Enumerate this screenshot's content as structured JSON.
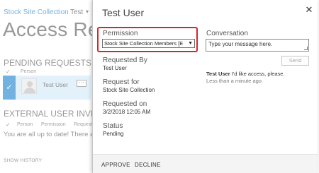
{
  "background": {
    "site_title": "Stock Site Collection",
    "top_nav": {
      "item": "Test",
      "caret": "▾"
    },
    "page_title": "Access Reque",
    "pending_requests": {
      "heading": "PENDING REQUESTS",
      "check_header": "✓",
      "columns": [
        "Person"
      ],
      "row": {
        "check": "✓",
        "name": "Test User",
        "menu": "···"
      }
    },
    "external_invitations": {
      "heading": "EXTERNAL USER INVITATIO",
      "check_header": "✓",
      "columns": [
        "Person",
        "Permission",
        "Requeste"
      ],
      "status_message": "You are all up to date! There ar"
    },
    "show_history": "SHOW HISTORY"
  },
  "dialog": {
    "title": "Test User",
    "close_icon": "✕",
    "permission": {
      "label": "Permission",
      "selected_value": "Stock Site Collection Members [E",
      "arrow": "▼"
    },
    "requested_by": {
      "label": "Requested By",
      "value": "Test User"
    },
    "request_for": {
      "label": "Request for",
      "value": "Stock Site Collection"
    },
    "requested_on": {
      "label": "Requested on",
      "value": "3/2/2018 12:05 AM"
    },
    "status": {
      "label": "Status",
      "value": "Pending"
    },
    "conversation": {
      "label": "Conversation",
      "placeholder": "Type your message here.",
      "send_label": "Send",
      "message": {
        "author": "Test User",
        "text": "I'd like access, please.",
        "time": "Less than a minute ago"
      }
    },
    "footer": {
      "approve_label": "APPROVE",
      "decline_label": "DECLINE"
    }
  },
  "colors": {
    "accent": "#0072c6",
    "selected_row": "#cde6f7",
    "highlight_border": "#d8242a"
  }
}
